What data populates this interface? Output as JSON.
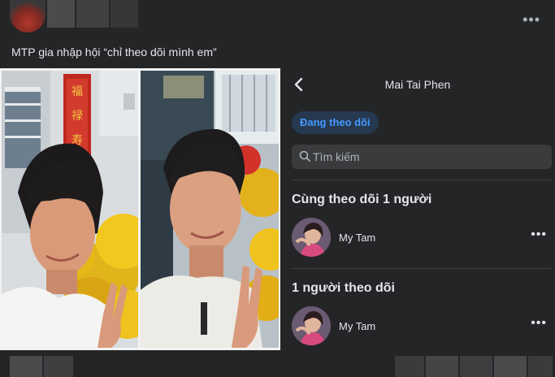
{
  "post": {
    "caption": "MTP gia nhập hội “chỉ theo dõi mình em”",
    "more_icon": "more-horizontal-icon"
  },
  "panel": {
    "title": "Mai Tai Phen",
    "follow_button": "Đang theo dõi",
    "search_placeholder": "Tìm kiếm",
    "sections": [
      {
        "title": "Cùng theo dõi 1 người",
        "user": "My Tam"
      },
      {
        "title": "1 người theo dõi",
        "user": "My Tam"
      }
    ]
  },
  "colors": {
    "background": "#242526",
    "accent": "#4599ff",
    "pill_bg": "#263951"
  }
}
